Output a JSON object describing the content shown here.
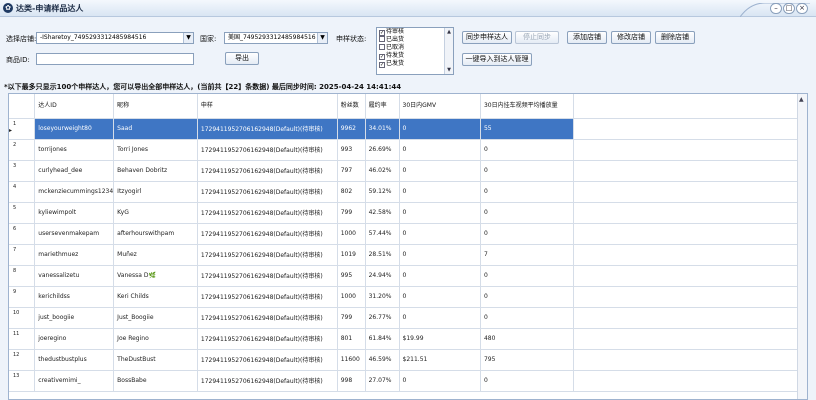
{
  "window": {
    "title": "达类-申请样品达人",
    "controls": {
      "minimize": "–",
      "maximize": "□",
      "close": "×"
    }
  },
  "filters": {
    "shop_label": "选择店铺:",
    "shop_value": "-ISharetoy_7495293312485984516",
    "country_label": "国家:",
    "country_value": "美国_7495293312485984516",
    "status_label": "申样状态:",
    "status_options": [
      {
        "label": "待审核",
        "checked": true
      },
      {
        "label": "已出货",
        "checked": false
      },
      {
        "label": "已取消",
        "checked": false
      },
      {
        "label": "待发货",
        "checked": true
      },
      {
        "label": "已发货",
        "checked": true
      }
    ],
    "product_label": "商品ID:",
    "product_value": "",
    "export_button": "导出"
  },
  "toolbar": {
    "sync_button": "同步申样达人",
    "stop_sync_button": "停止同步",
    "add_shop_button": "添加店铺",
    "edit_shop_button": "修改店铺",
    "delete_shop_button": "删除店铺",
    "import_button": "一键导入到达人管理"
  },
  "notice": "*以下最多只显示100个申样达人，您可以导出全部申样达人，(当前共【22】条数据) 最后同步时间: 2025-04-24 14:41:44",
  "table": {
    "headers": [
      "达人ID",
      "昵称",
      "申样",
      "粉丝数",
      "履约率",
      "30日内GMV",
      "30日内挂车视频平均播放量"
    ],
    "rows": [
      {
        "n": "1",
        "id": "loseyourweight80",
        "nick": "Saad",
        "sample": "1729411952706162948(Default)(待审核)",
        "fans": "9962",
        "rate": "34.01%",
        "gmv": "0",
        "avg": "55",
        "selected": true
      },
      {
        "n": "2",
        "id": "torrijones",
        "nick": "Torri Jones",
        "sample": "1729411952706162948(Default)(待审核)",
        "fans": "993",
        "rate": "26.69%",
        "gmv": "0",
        "avg": "0"
      },
      {
        "n": "3",
        "id": "curlyhead_dee",
        "nick": "Behaven Dobritz",
        "sample": "1729411952706162948(Default)(待审核)",
        "fans": "797",
        "rate": "46.02%",
        "gmv": "0",
        "avg": "0"
      },
      {
        "n": "4",
        "id": "mckenziecummings1234",
        "nick": "Itzyogirl",
        "sample": "1729411952706162948(Default)(待审核)",
        "fans": "802",
        "rate": "59.12%",
        "gmv": "0",
        "avg": "0"
      },
      {
        "n": "5",
        "id": "kyliewimpolt",
        "nick": "KyG",
        "sample": "1729411952706162948(Default)(待审核)",
        "fans": "799",
        "rate": "42.58%",
        "gmv": "0",
        "avg": "0"
      },
      {
        "n": "6",
        "id": "usersevenmakepam",
        "nick": "afterhourswithpam",
        "sample": "1729411952706162948(Default)(待审核)",
        "fans": "1000",
        "rate": "57.44%",
        "gmv": "0",
        "avg": "0"
      },
      {
        "n": "7",
        "id": "mariethmuez",
        "nick": "Muñez",
        "sample": "1729411952706162948(Default)(待审核)",
        "fans": "1019",
        "rate": "28.51%",
        "gmv": "0",
        "avg": "7"
      },
      {
        "n": "8",
        "id": "vanessalizetu",
        "nick": "Vanessa D🌿",
        "sample": "1729411952706162948(Default)(待审核)",
        "fans": "995",
        "rate": "24.94%",
        "gmv": "0",
        "avg": "0"
      },
      {
        "n": "9",
        "id": "kerichildss",
        "nick": "Keri Childs",
        "sample": "1729411952706162948(Default)(待审核)",
        "fans": "1000",
        "rate": "31.20%",
        "gmv": "0",
        "avg": "0"
      },
      {
        "n": "10",
        "id": "just_boogiie",
        "nick": "Just_Boogiie",
        "sample": "1729411952706162948(Default)(待审核)",
        "fans": "799",
        "rate": "26.77%",
        "gmv": "0",
        "avg": "0"
      },
      {
        "n": "11",
        "id": "joeregino",
        "nick": "Joe Regino",
        "sample": "1729411952706162948(Default)(待审核)",
        "fans": "801",
        "rate": "61.84%",
        "gmv": "$19.99",
        "avg": "480"
      },
      {
        "n": "12",
        "id": "thedustbustplus",
        "nick": "TheDustBust",
        "sample": "1729411952706162948(Default)(待审核)",
        "fans": "11600",
        "rate": "46.59%",
        "gmv": "$211.51",
        "avg": "795"
      },
      {
        "n": "13",
        "id": "creativemimi_",
        "nick": "BossBabe",
        "sample": "1729411952706162948(Default)(待审核)",
        "fans": "998",
        "rate": "27.07%",
        "gmv": "0",
        "avg": "0"
      }
    ]
  },
  "colors": {
    "selected_row": "#3f76c4",
    "window_bg": "#eef3fa"
  }
}
